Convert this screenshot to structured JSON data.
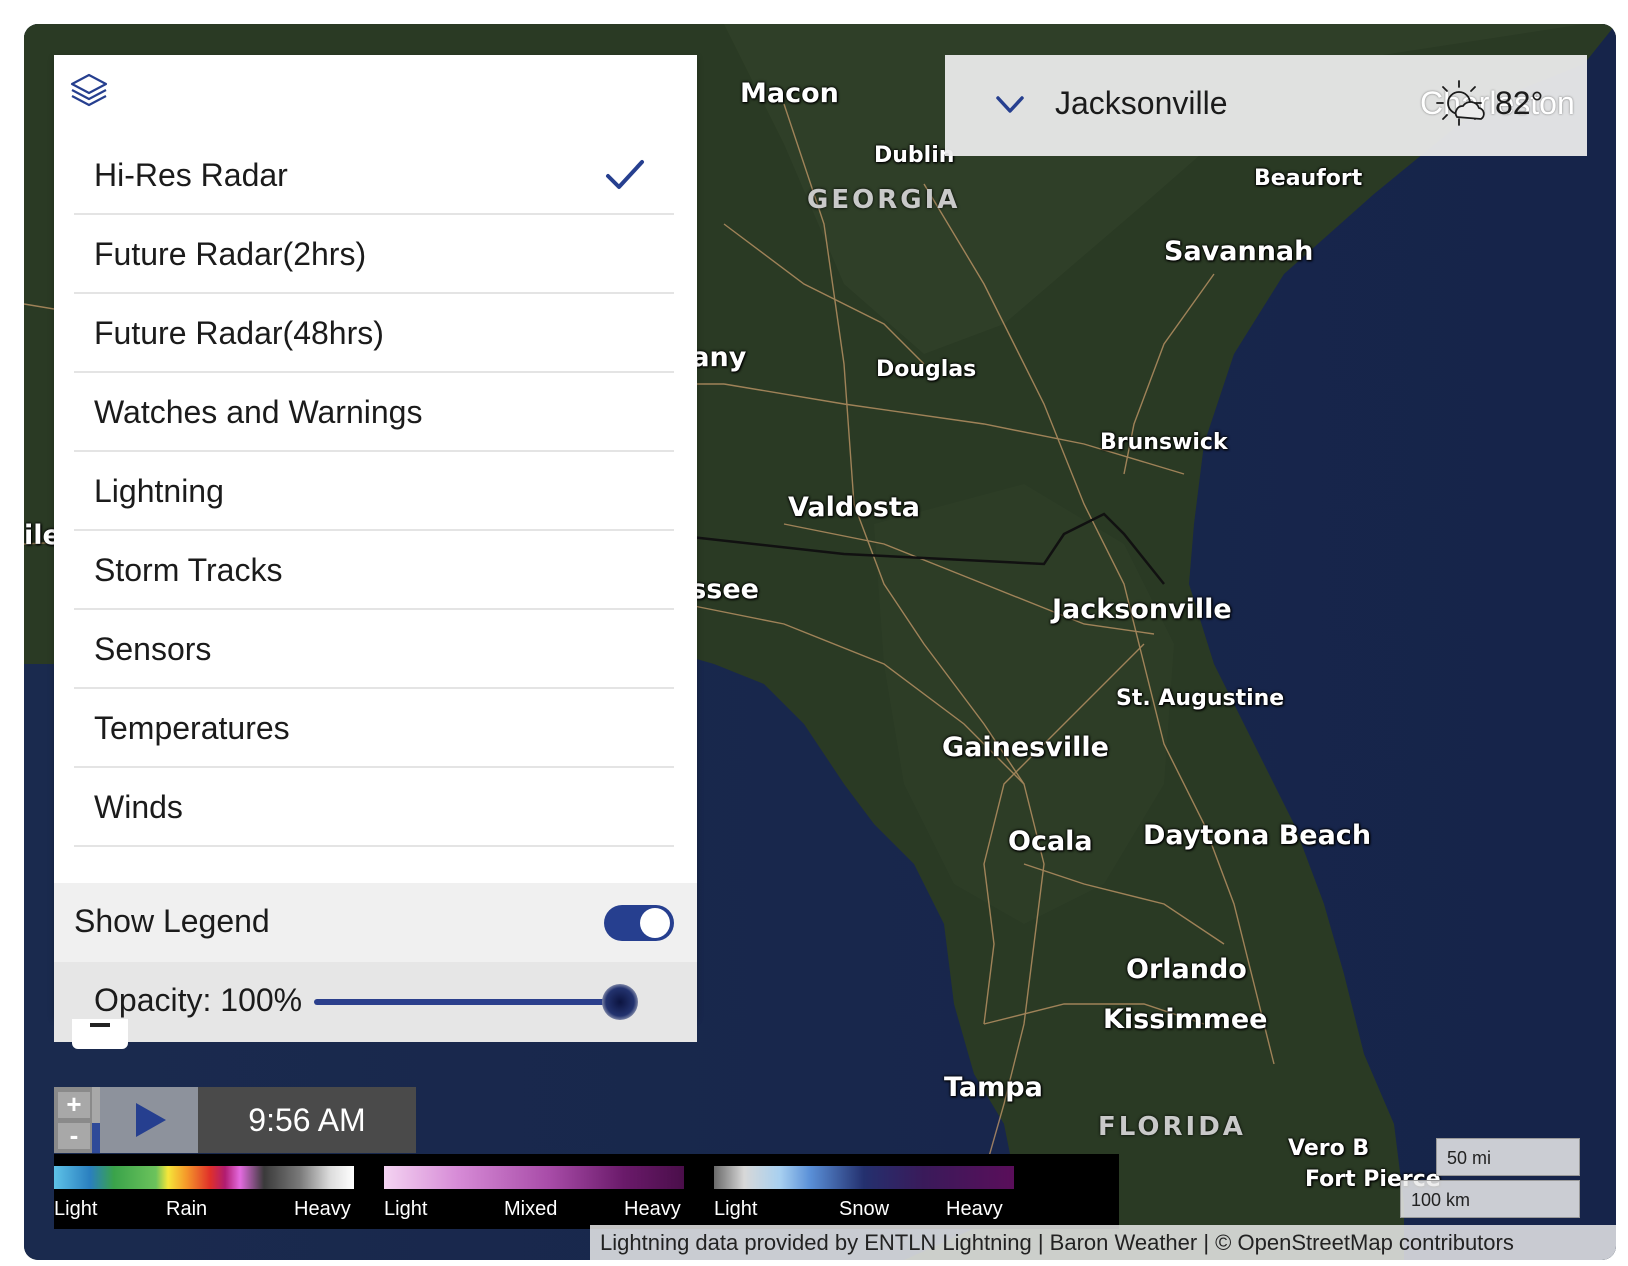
{
  "map": {
    "cities": [
      {
        "name": "Macon"
      },
      {
        "name": "Dublin"
      },
      {
        "name": "Beaufort"
      },
      {
        "name": "Savannah"
      },
      {
        "name": "bany"
      },
      {
        "name": "Douglas"
      },
      {
        "name": "Brunswick"
      },
      {
        "name": "Valdosta"
      },
      {
        "name": "assee"
      },
      {
        "name": "Jacksonville"
      },
      {
        "name": "St. Augustine"
      },
      {
        "name": "Gainesville"
      },
      {
        "name": "Ocala"
      },
      {
        "name": "Daytona Beach"
      },
      {
        "name": "Orlando"
      },
      {
        "name": "Kissimmee"
      },
      {
        "name": "Tampa"
      },
      {
        "name": "Vero B"
      },
      {
        "name": "ile"
      },
      {
        "name": "Fort Pierce"
      }
    ],
    "states": [
      {
        "name": "GEORGIA"
      },
      {
        "name": "FLORIDA"
      }
    ]
  },
  "location": {
    "name": "Jacksonville",
    "background_label": "Charleston",
    "temperature": "82°",
    "weather_icon": "partly-cloudy-icon",
    "chevron_icon": "chevron-down-icon"
  },
  "layers_panel": {
    "icon": "layers-icon",
    "items": [
      {
        "label": "Hi-Res Radar",
        "checked": true
      },
      {
        "label": "Future Radar(2hrs)",
        "checked": false
      },
      {
        "label": "Future Radar(48hrs)",
        "checked": false
      },
      {
        "label": "Watches and Warnings",
        "checked": false
      },
      {
        "label": "Lightning",
        "checked": false
      },
      {
        "label": "Storm Tracks",
        "checked": false
      },
      {
        "label": "Sensors",
        "checked": false
      },
      {
        "label": "Temperatures",
        "checked": false
      },
      {
        "label": "Winds",
        "checked": false
      }
    ],
    "show_legend_label": "Show Legend",
    "show_legend_on": true,
    "opacity_label": "Opacity: 100%",
    "opacity_value": 1.0,
    "accent_color": "#263f8f"
  },
  "player": {
    "zoom_in": "+",
    "zoom_out": "-",
    "time": "9:56 AM"
  },
  "legend": {
    "rain": {
      "labels": [
        "Light",
        "Rain",
        "Heavy"
      ]
    },
    "mixed": {
      "labels": [
        "Light",
        "Mixed",
        "Heavy"
      ]
    },
    "snow": {
      "labels": [
        "Light",
        "Snow",
        "Heavy"
      ]
    }
  },
  "scale": {
    "miles": "50 mi",
    "km": "100 km"
  },
  "attribution": "Lightning data provided by ENTLN Lightning | Baron Weather | © OpenStreetMap contributors"
}
